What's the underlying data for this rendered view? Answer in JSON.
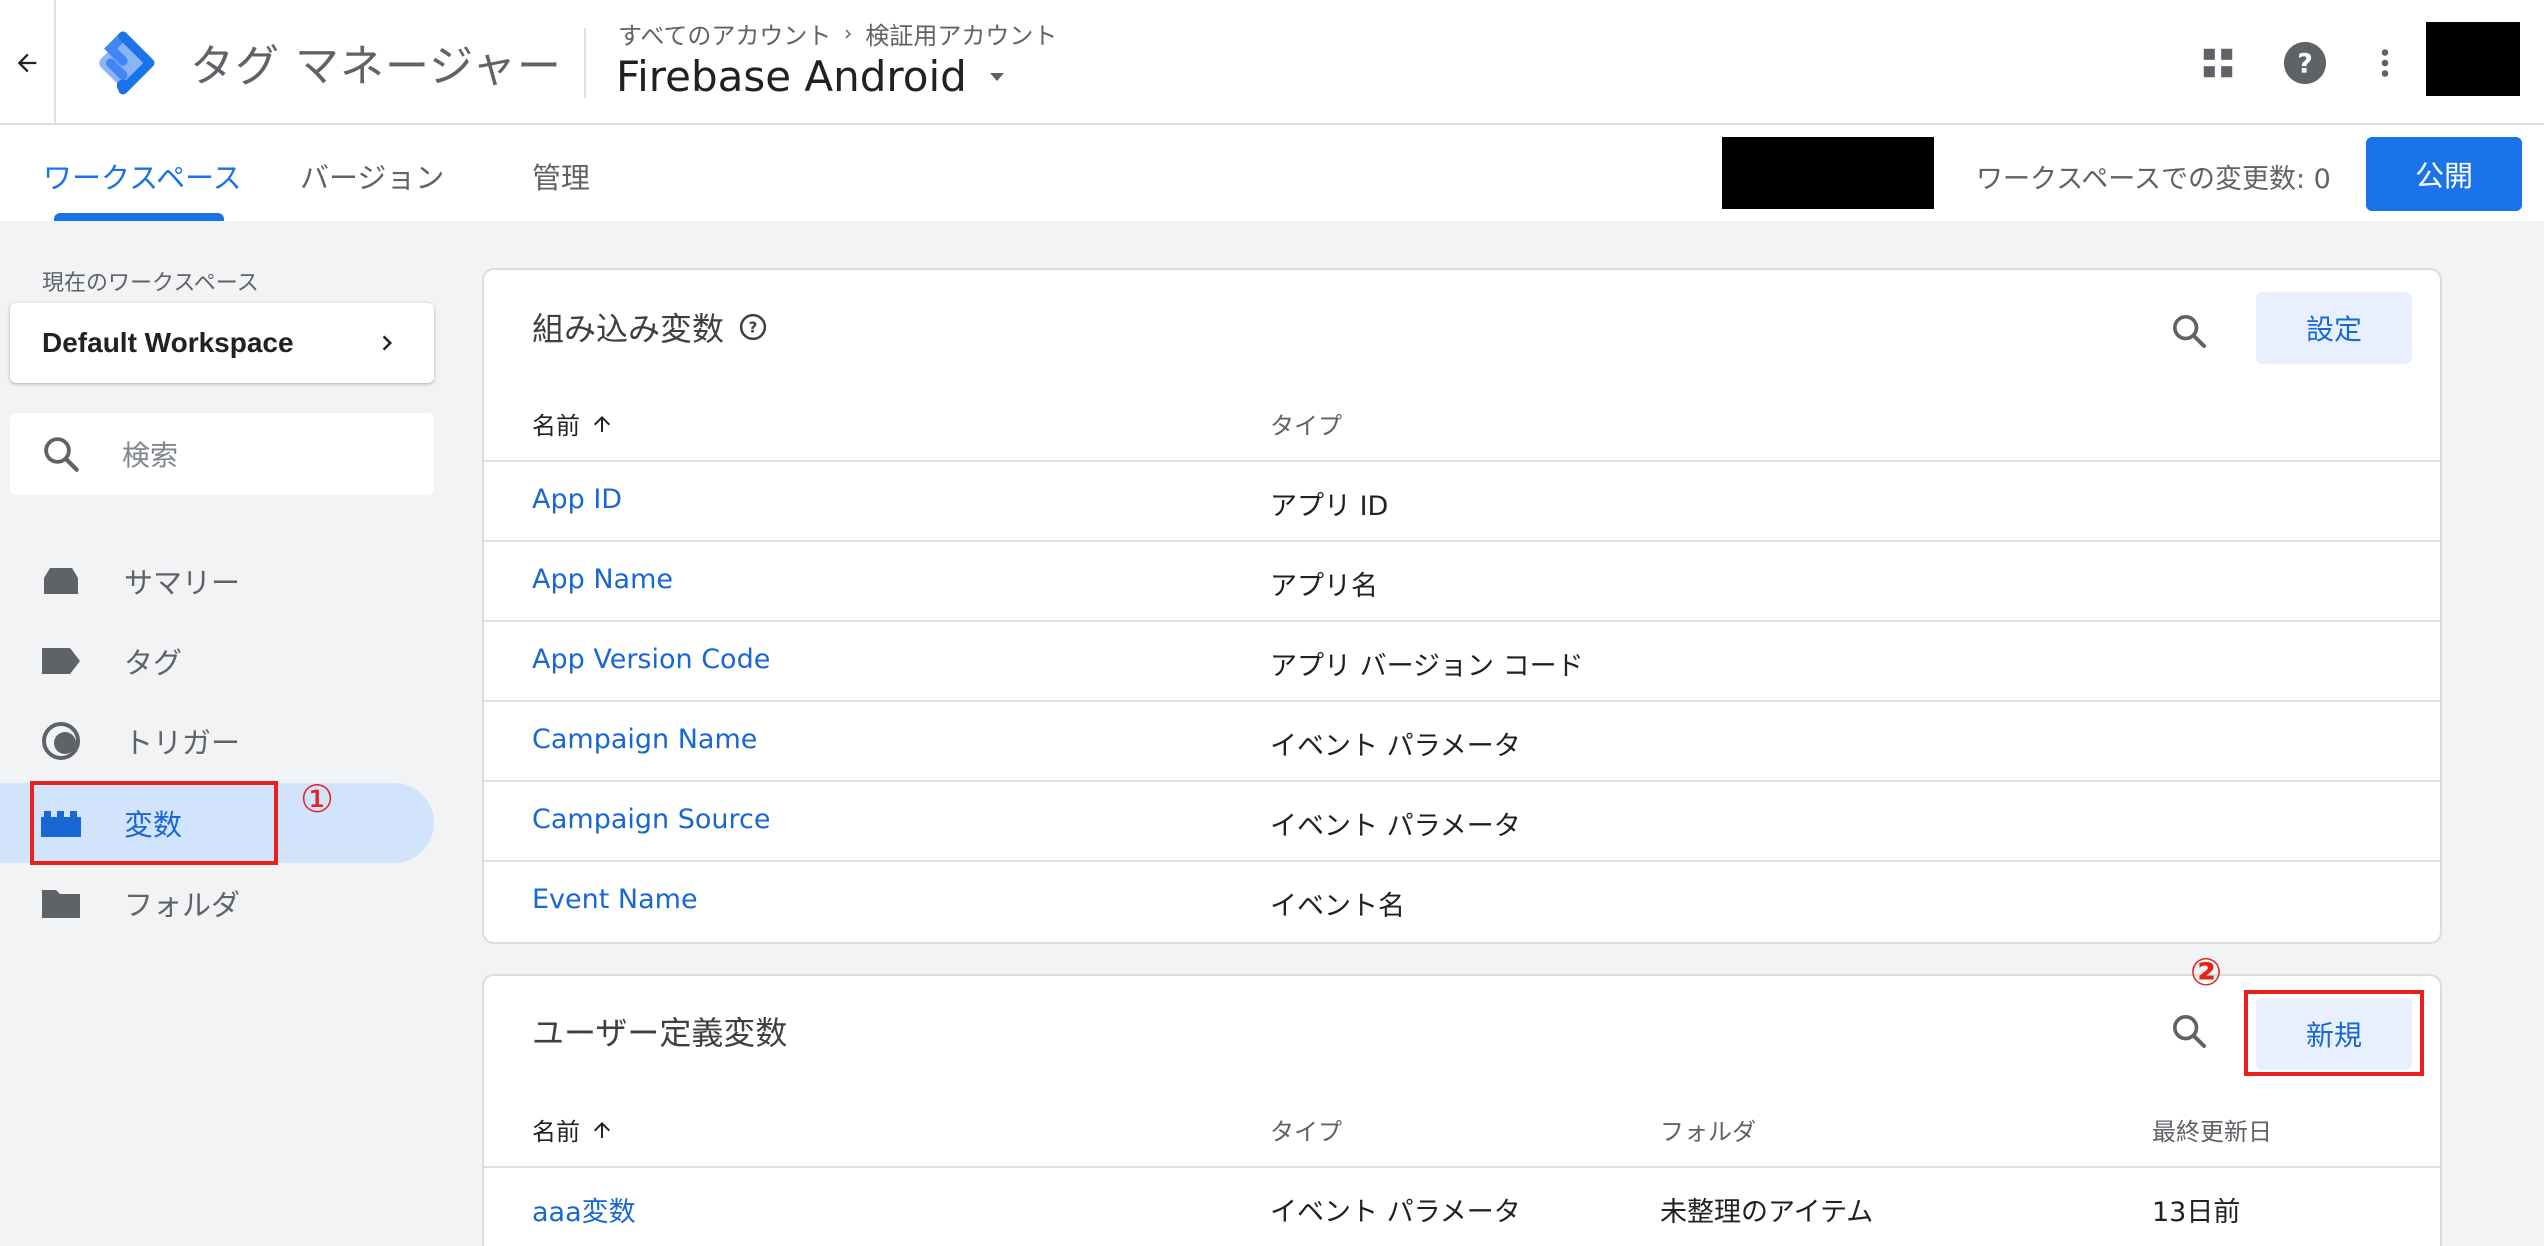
{
  "header": {
    "back_icon": "arrow-back-icon",
    "logo_icon": "tag-manager-logo",
    "product_name": "タグ マネージャー",
    "breadcrumb_account": "すべてのアカウント",
    "breadcrumb_sep_icon": "chevron-right-icon",
    "breadcrumb_current": "検証用アカウント",
    "container_name": "Firebase Android",
    "icons": [
      "apps-grid-icon",
      "help-icon",
      "more-vert-icon"
    ]
  },
  "nav": {
    "tabs": [
      {
        "label": "ワークスペース",
        "active": true
      },
      {
        "label": "バージョン",
        "active": false
      },
      {
        "label": "管理",
        "active": false
      }
    ],
    "changes_label": "ワークスペースでの変更数: 0",
    "publish_label": "公開",
    "accent": "#1a73e8"
  },
  "sidebar": {
    "workspace_label": "現在のワークスペース",
    "workspace_name": "Default Workspace",
    "search_placeholder": "検索",
    "items": [
      {
        "label": "サマリー",
        "icon": "inbox-icon",
        "active": false
      },
      {
        "label": "タグ",
        "icon": "label-icon",
        "active": false
      },
      {
        "label": "トリガー",
        "icon": "trigger-icon",
        "active": false
      },
      {
        "label": "変数",
        "icon": "variable-blocks-icon",
        "active": true
      },
      {
        "label": "フォルダ",
        "icon": "folder-icon",
        "active": false
      }
    ],
    "annotation_1": "①"
  },
  "builtin": {
    "title": "組み込み変数",
    "settings_label": "設定",
    "col_name": "名前",
    "col_type": "タイプ",
    "rows": [
      {
        "name": "App ID",
        "type": "アプリ ID"
      },
      {
        "name": "App Name",
        "type": "アプリ名"
      },
      {
        "name": "App Version Code",
        "type": "アプリ バージョン コード"
      },
      {
        "name": "Campaign Name",
        "type": "イベント パラメータ"
      },
      {
        "name": "Campaign Source",
        "type": "イベント パラメータ"
      },
      {
        "name": "Event Name",
        "type": "イベント名"
      }
    ]
  },
  "user_defined": {
    "title": "ユーザー定義変数",
    "new_label": "新規",
    "annotation_2": "②",
    "col_name": "名前",
    "col_type": "タイプ",
    "col_folder": "フォルダ",
    "col_updated": "最終更新日",
    "rows": [
      {
        "name": "aaa変数",
        "type": "イベント パラメータ",
        "folder": "未整理のアイテム",
        "updated": "13日前"
      }
    ]
  },
  "colors": {
    "link": "#1967d2",
    "annotation": "#e8211d",
    "sidebar_active": "#d2e3fc"
  }
}
